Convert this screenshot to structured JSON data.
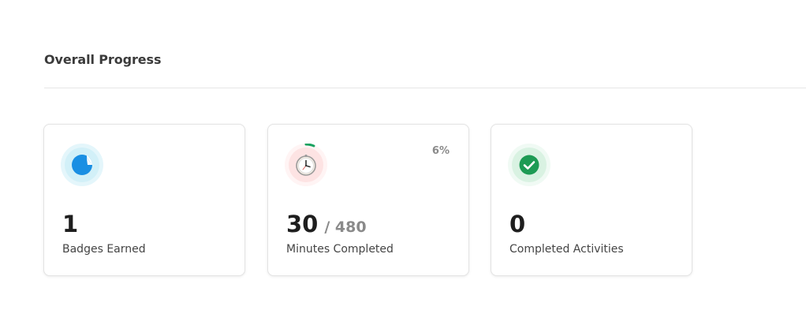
{
  "section": {
    "title": "Overall Progress"
  },
  "cards": [
    {
      "icon": "badge-sticker-icon",
      "value": "1",
      "label": "Badges Earned",
      "accent": "#1a8fe3",
      "icon_bg": "#e4f6fb"
    },
    {
      "icon": "clock-icon",
      "value": "30",
      "total": "/ 480",
      "label": "Minutes Completed",
      "percent": "6%",
      "progress": 0.0625,
      "accent": "#1aa260",
      "icon_bg": "#fde5e5"
    },
    {
      "icon": "checkmark-icon",
      "value": "0",
      "label": "Completed Activities",
      "accent": "#1d9b54",
      "icon_bg": "#e5f6ec"
    }
  ]
}
